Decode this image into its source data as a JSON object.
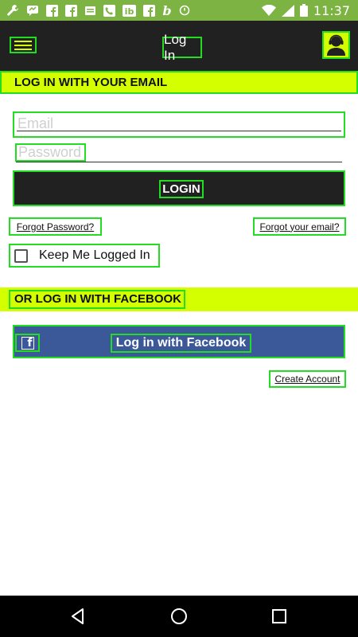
{
  "status_bar": {
    "time": "11:37",
    "notification_icons": [
      "wrench-icon",
      "messenger-icon",
      "fb-app-icon",
      "fb-app-icon",
      "news-icon",
      "phone-icon",
      "ib-icon",
      "fb-app-icon",
      "b-icon",
      "timer-icon"
    ],
    "system_icons": [
      "wifi-icon",
      "signal-icon",
      "battery-icon"
    ]
  },
  "app_bar": {
    "title": "Log In",
    "menu_icon": "hamburger-menu-icon",
    "avatar_icon": "user-avatar-icon"
  },
  "email_section": {
    "heading": "LOG IN WITH YOUR EMAIL",
    "email_placeholder": "Email",
    "email_value": "",
    "password_placeholder": "Password",
    "password_value": "",
    "login_label": "LOGIN",
    "forgot_password": "Forgot Password?",
    "forgot_email": "Forgot your email?",
    "keep_logged_in": "Keep Me Logged In",
    "keep_logged_in_checked": false
  },
  "facebook_section": {
    "heading": "OR LOG IN WITH FACEBOOK",
    "button_label": "Log in with Facebook",
    "icon": "facebook-icon"
  },
  "create_account": "Create Account",
  "nav_bar": {
    "buttons": [
      "back-icon",
      "home-icon",
      "recents-icon"
    ]
  },
  "colors": {
    "status_bar": "#7cb342",
    "app_bar": "#212121",
    "accent": "#d4ff00",
    "facebook": "#3b5998",
    "highlight": "#22dd22"
  }
}
